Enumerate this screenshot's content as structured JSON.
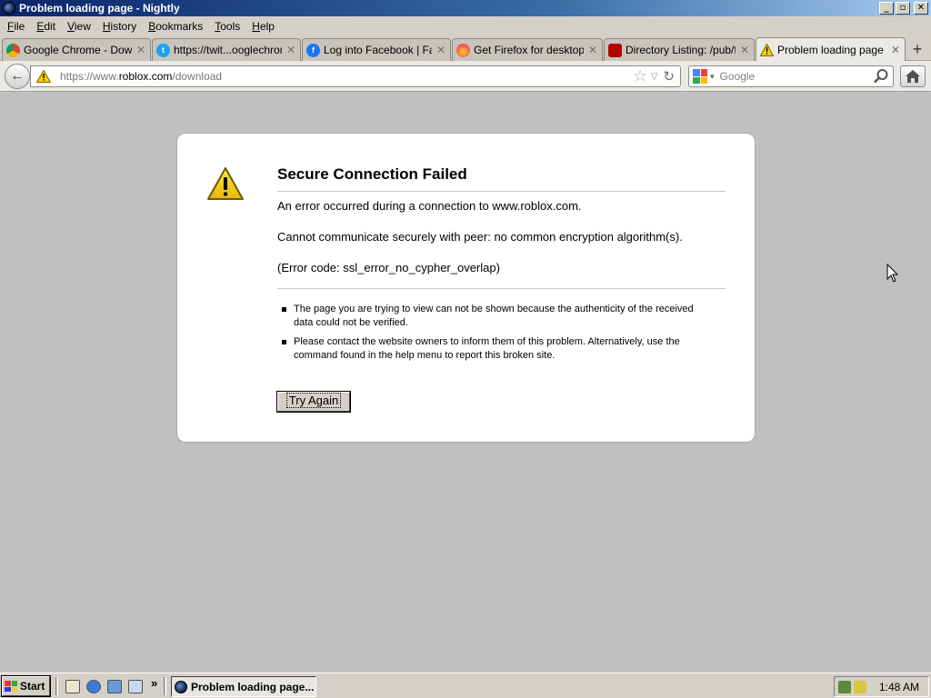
{
  "window": {
    "title": "Problem loading page - Nightly",
    "minimize_glyph": "_",
    "maximize_glyph": "▫",
    "close_glyph": "✕"
  },
  "menu": {
    "items": [
      {
        "accel": "F",
        "rest": "ile"
      },
      {
        "accel": "E",
        "rest": "dit"
      },
      {
        "accel": "V",
        "rest": "iew"
      },
      {
        "accel": "H",
        "rest": "istory"
      },
      {
        "accel": "B",
        "rest": "ookmarks"
      },
      {
        "accel": "T",
        "rest": "ools"
      },
      {
        "accel": "H",
        "rest": "elp"
      }
    ]
  },
  "tabs": [
    {
      "label": "Google Chrome - Downl...",
      "icon": "chrome-icon"
    },
    {
      "label": "https://twit...ooglechrome",
      "icon": "twitter-icon"
    },
    {
      "label": "Log into Facebook | Fac...",
      "icon": "facebook-icon"
    },
    {
      "label": "Get Firefox for desktop –...",
      "icon": "firefox-icon"
    },
    {
      "label": "Directory Listing: /pub/fir...",
      "icon": "directory-icon"
    },
    {
      "label": "Problem loading page",
      "icon": "warning-icon",
      "active": true
    }
  ],
  "tab_close_glyph": "✕",
  "new_tab_glyph": "+",
  "navbar": {
    "back_glyph": "←",
    "url_prefix": "https://www.",
    "url_host": "roblox.com",
    "url_suffix": "/download",
    "star_glyph": "☆",
    "dropdown_glyph": "▽",
    "reload_glyph": "↻",
    "search_placeholder": "Google",
    "search_dropdown_glyph": "▾"
  },
  "error": {
    "title": "Secure Connection Failed",
    "message1": "An error occurred during a connection to www.roblox.com.",
    "message2": "Cannot communicate securely with peer: no common encryption algorithm(s).",
    "message3": "(Error code: ssl_error_no_cypher_overlap)",
    "bullets": [
      "The page you are trying to view can not be shown because the authenticity of the received data could not be verified.",
      "Please contact the website owners to inform them of this problem. Alternatively, use the command found in the help menu to report this broken site."
    ],
    "try_again": "Try Again"
  },
  "taskbar": {
    "start_label": "Start",
    "more_glyph": "»",
    "task_label": "Problem loading page...",
    "clock": "1:48 AM"
  },
  "colors": {
    "titlebar": "#0a246a",
    "chrome": "#d4d0c8",
    "content_bg": "#c0c0c0",
    "warning_yellow": "#f5d000"
  }
}
